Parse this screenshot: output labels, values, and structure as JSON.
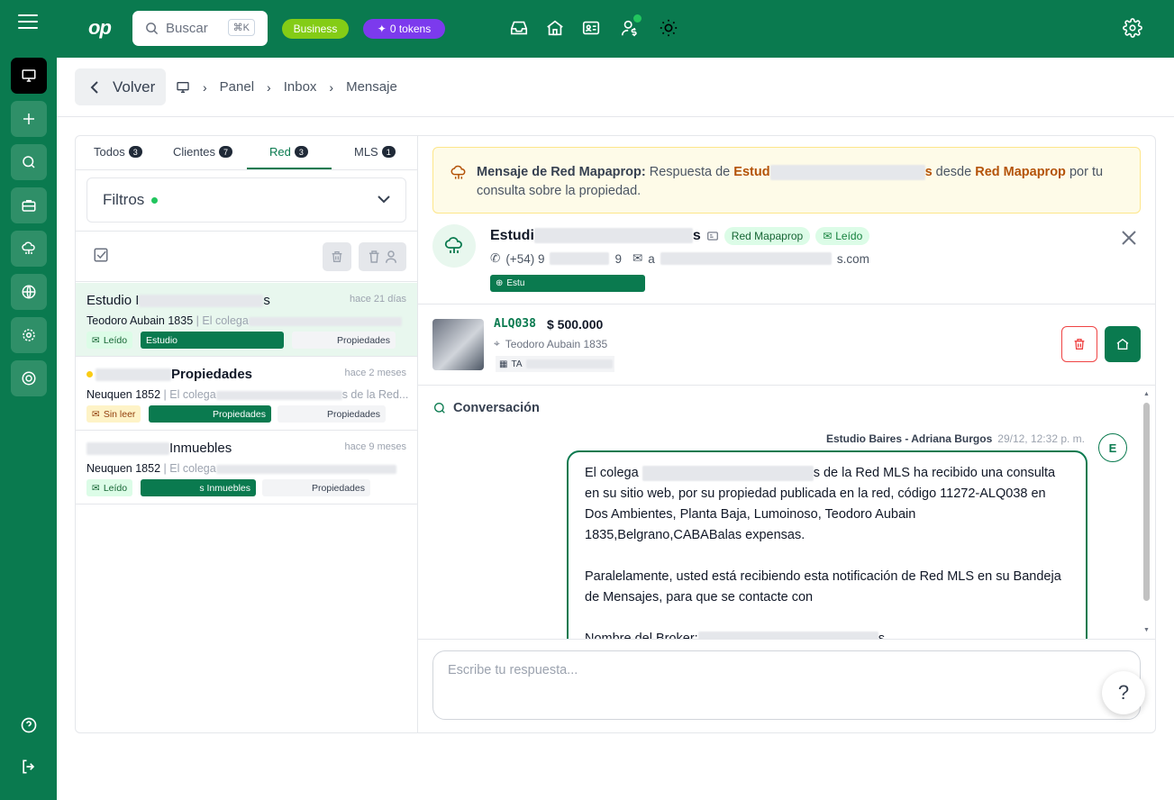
{
  "topbar": {
    "logo": "op",
    "search_placeholder": "Buscar",
    "search_kbd": "⌘K",
    "plan_badge": "Business",
    "tokens_badge": "0 tokens",
    "icons": [
      "inbox-icon",
      "home-icon",
      "id-card-icon",
      "user-dollar-icon",
      "sun-icon",
      "gear-icon"
    ]
  },
  "sidebar": {
    "items": [
      "monitor-icon",
      "plus-icon",
      "chat-icon",
      "briefcase-icon",
      "cloud-network-icon",
      "globe-icon",
      "settings-icon",
      "support-icon"
    ],
    "bottom": [
      "help-icon",
      "logout-icon"
    ]
  },
  "header": {
    "back_label": "Volver",
    "breadcrumbs": [
      "Panel",
      "Inbox",
      "Mensaje"
    ]
  },
  "tabs": [
    {
      "label": "Todos",
      "count": "3"
    },
    {
      "label": "Clientes",
      "count": "7"
    },
    {
      "label": "Red",
      "count": "3"
    },
    {
      "label": "MLS",
      "count": "1"
    }
  ],
  "filters": {
    "label": "Filtros"
  },
  "messages": [
    {
      "name_prefix": "Estudio I",
      "name_suffix": "s",
      "when": "hace 21 días",
      "address": "Teodoro Aubain 1835",
      "snippet": "El colega",
      "status": "Leído",
      "tag1": "Estudio",
      "tag2": "Propiedades"
    },
    {
      "name_prefix": "",
      "name_suffix": "Propiedades",
      "when": "hace 2 meses",
      "address": "Neuquen 1852",
      "snippet": "El colega",
      "snippet_end": "s de la Red...",
      "status": "Sin leer",
      "tag1": "Propiedades",
      "tag2": "Propiedades"
    },
    {
      "name_prefix": "",
      "name_suffix": "Inmuebles",
      "when": "hace 9 meses",
      "address": "Neuquen 1852",
      "snippet": "El colega",
      "status": "Leído",
      "tag1": "s Inmuebles",
      "tag2": "Propiedades"
    }
  ],
  "notice": {
    "title": "Mensaje de Red Mapaprop:",
    "text1": "Respuesta de",
    "sender": "Estud",
    "sender_end": "s",
    "text2": "desde",
    "network": "Red Mapaprop",
    "text3": "por tu consulta sobre la propiedad."
  },
  "contact": {
    "name_prefix": "Estudi",
    "name_suffix": "s",
    "badge_network": "Red Mapaprop",
    "badge_status": "Leído",
    "phone_prefix": "(+54) 9",
    "phone_suffix": "9",
    "email_prefix": "a",
    "email_suffix": "s.com",
    "web": "Estu"
  },
  "property": {
    "code": "ALQ038",
    "price": "$ 500.000",
    "address": "Teodoro Aubain 1835",
    "tag": "TA"
  },
  "conversation": {
    "title": "Conversación",
    "sender": "Estudio Baires - Adriana Burgos",
    "time": "29/12, 12:32 p. m.",
    "avatar": "E",
    "p1_a": "El colega",
    "p1_b": "s de la Red MLS ha recibido una consulta en su sitio web, por su propiedad publicada en la red, código 11272-ALQ038 en Dos Ambientes, Planta Baja, Lumoinoso, Teodoro Aubain 1835,Belgrano,CABABalas expensas.",
    "p2": "Paralelamente, usted está recibiendo esta notificación de Red MLS en su Bandeja de Mensajes, para que se contacte con",
    "p3_a": "Nombre del Broker:",
    "p3_b": "s"
  },
  "reply": {
    "placeholder": "Escribe tu respuesta..."
  },
  "help": {
    "label": "?"
  }
}
